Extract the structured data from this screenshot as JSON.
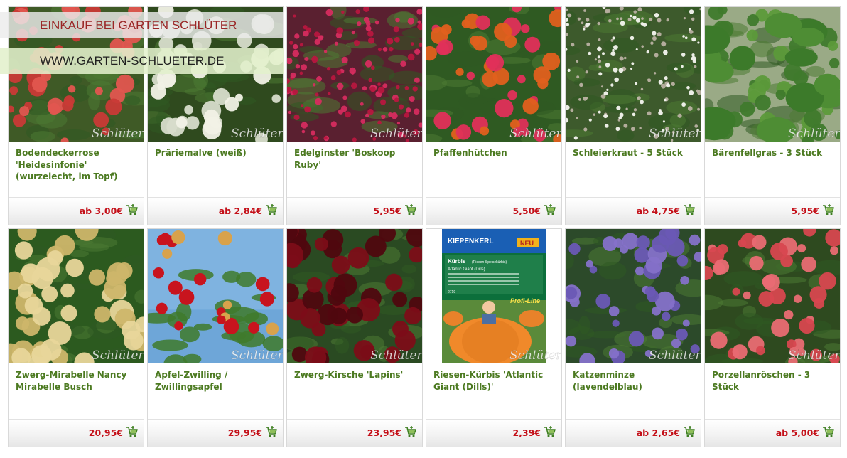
{
  "banner": {
    "title": "EINKAUF BEI GARTEN SCHLÜTER",
    "url": "WWW.GARTEN-SCHLUETER.DE"
  },
  "watermark": "Schlüter",
  "products": [
    {
      "name": "Bodendeckerrose 'Heidesinfonie' (wurzelecht, im Topf)",
      "price": "ab 3,00€",
      "photo_colors": [
        "#3f5a26",
        "#e2564f",
        "#c93a36"
      ]
    },
    {
      "name": "Präriemalve (weiß)",
      "price": "ab 2,84€",
      "photo_colors": [
        "#2f4a1e",
        "#f1f1e6",
        "#d7dccb"
      ]
    },
    {
      "name": "Edelginster 'Boskoop Ruby'",
      "price": "5,95€",
      "photo_colors": [
        "#5a2030",
        "#d62c5f",
        "#b8173f"
      ]
    },
    {
      "name": "Pfaffenhütchen",
      "price": "5,50€",
      "photo_colors": [
        "#2f5a22",
        "#e0305a",
        "#e0601d"
      ]
    },
    {
      "name": "Schleierkraut - 5 Stück",
      "price": "ab 4,75€",
      "photo_colors": [
        "#3d5a2c",
        "#f5f5f0",
        "#b9b1a2"
      ]
    },
    {
      "name": "Bärenfellgras - 3 Stück",
      "price": "5,95€",
      "photo_colors": [
        "#9aaa86",
        "#3f7a2c",
        "#5c9a3a"
      ]
    },
    {
      "name": "Zwerg-Mirabelle Nancy Mirabelle Busch",
      "price": "20,95€",
      "photo_colors": [
        "#2c5a1f",
        "#e8d69a",
        "#cdb66a"
      ]
    },
    {
      "name": "Apfel-Zwilling / Zwillingsapfel",
      "price": "29,95€",
      "photo_colors": [
        "#6ea6d8",
        "#c8141e",
        "#3c7a2a"
      ]
    },
    {
      "name": "Zwerg-Kirsche 'Lapins'",
      "price": "23,95€",
      "photo_colors": [
        "#2a4a22",
        "#7c0d18",
        "#4f070f"
      ]
    },
    {
      "name": "Riesen-Kürbis 'Atlantic Giant (Dills)'",
      "price": "2,39€",
      "photo_colors": [
        "#0d6a39",
        "#f08a2c",
        "#d9691a"
      ]
    },
    {
      "name": "Katzenminze (lavendelblau)",
      "price": "ab 2,65€",
      "photo_colors": [
        "#2c4a2a",
        "#8571c9",
        "#6a58b5"
      ]
    },
    {
      "name": "Porzellanröschen - 3 Stück",
      "price": "ab 5,00€",
      "photo_colors": [
        "#2e4a1f",
        "#e96c73",
        "#d7474f"
      ]
    }
  ],
  "seed_packet": {
    "brand": "KIEPENKERL",
    "badge": "NEU",
    "title": "Kürbis",
    "subtitle": "(Riesen-Speisekürbis)",
    "variety": "Atlantic Giant (Dills)",
    "number": "2719",
    "line": "Profi-Line"
  },
  "icons": {
    "cart": "shopping-cart-icon"
  },
  "colors": {
    "product_name": "#4c7a21",
    "price": "#c41019",
    "banner_title": "#9a2626"
  }
}
